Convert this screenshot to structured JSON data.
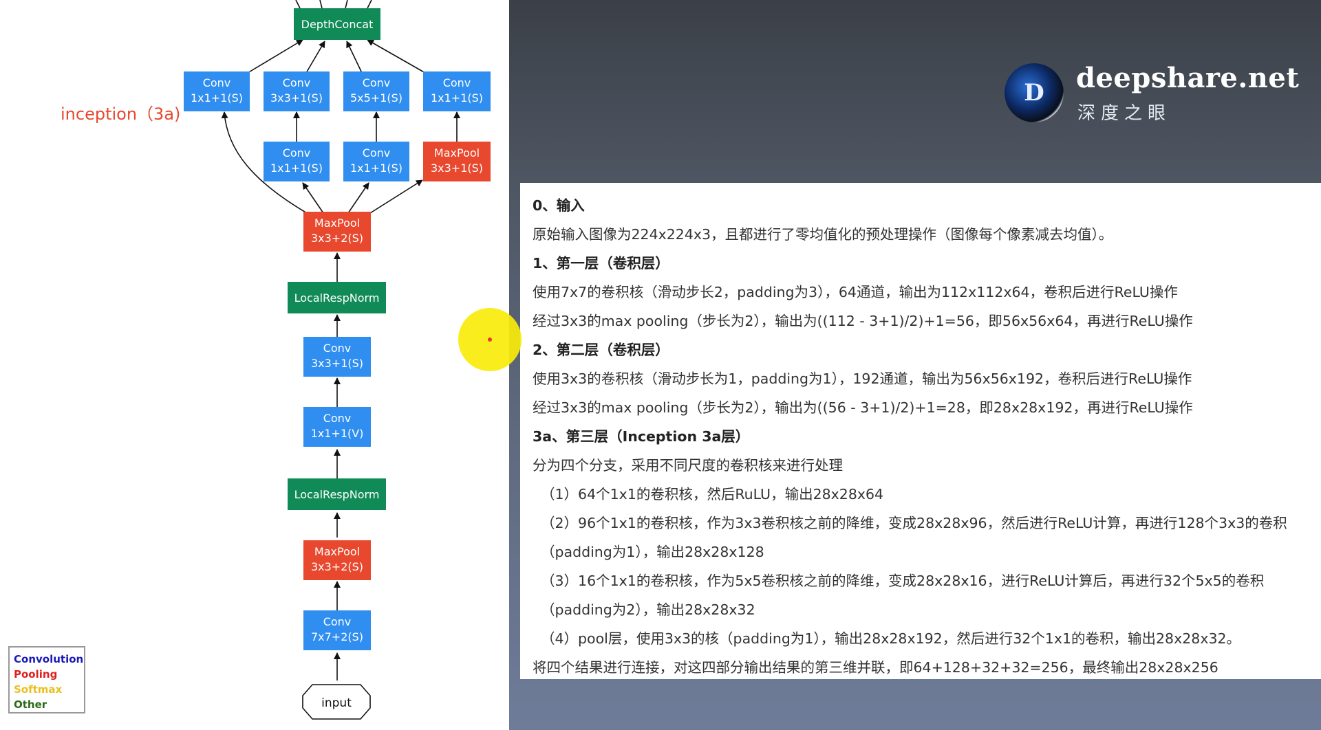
{
  "diagram": {
    "label": "inception（3a)",
    "nodes": {
      "depthconcat": [
        "DepthConcat"
      ],
      "conv_1x1_a": [
        "Conv",
        "1x1+1(S)"
      ],
      "conv_3x3": [
        "Conv",
        "3x3+1(S)"
      ],
      "conv_5x5": [
        "Conv",
        "5x5+1(S)"
      ],
      "conv_1x1_b": [
        "Conv",
        "1x1+1(S)"
      ],
      "conv_1x1_c": [
        "Conv",
        "1x1+1(S)"
      ],
      "conv_1x1_d": [
        "Conv",
        "1x1+1(S)"
      ],
      "maxpool_3x3_s1": [
        "MaxPool",
        "3x3+1(S)"
      ],
      "maxpool_3x3_s2_top": [
        "MaxPool",
        "3x3+2(S)"
      ],
      "localrespnorm_top": [
        "LocalRespNorm"
      ],
      "conv_3x3_s": [
        "Conv",
        "3x3+1(S)"
      ],
      "conv_1x1_v": [
        "Conv",
        "1x1+1(V)"
      ],
      "localrespnorm_bottom": [
        "LocalRespNorm"
      ],
      "maxpool_3x3_s2_bottom": [
        "MaxPool",
        "3x3+2(S)"
      ],
      "conv_7x7": [
        "Conv",
        "7x7+2(S)"
      ],
      "input": [
        "input"
      ]
    },
    "colors": {
      "convolution": "#2f8ef0",
      "pooling": "#e8482e",
      "norm_concat": "#108a56"
    }
  },
  "legend": {
    "items": [
      {
        "label": "Convolution",
        "color": "#1a1ab8"
      },
      {
        "label": "Pooling",
        "color": "#e02020"
      },
      {
        "label": "Softmax",
        "color": "#e8c020"
      },
      {
        "label": "Other",
        "color": "#2a6a1a"
      }
    ]
  },
  "logo": {
    "letter": "D",
    "title": "deepshare.net",
    "subtitle": "深度之眼"
  },
  "notes": {
    "lines": [
      "0、输入",
      "原始输入图像为224x224x3，且都进行了零均值化的预处理操作（图像每个像素减去均值）。",
      "1、第一层（卷积层）",
      "使用7x7的卷积核（滑动步长2，padding为3），64通道，输出为112x112x64，卷积后进行ReLU操作",
      "经过3x3的max pooling（步长为2），输出为((112 - 3+1)/2)+1=56，即56x56x64，再进行ReLU操作",
      "2、第二层（卷积层）",
      "使用3x3的卷积核（滑动步长为1，padding为1），192通道，输出为56x56x192，卷积后进行ReLU操作",
      "经过3x3的max pooling（步长为2），输出为((56 - 3+1)/2)+1=28，即28x28x192，再进行ReLU操作",
      "3a、第三层（Inception 3a层）",
      "分为四个分支，采用不同尺度的卷积核来进行处理",
      "（1）64个1x1的卷积核，然后RuLU，输出28x28x64",
      "（2）96个1x1的卷积核，作为3x3卷积核之前的降维，变成28x28x96，然后进行ReLU计算，再进行128个3x3的卷积",
      "（padding为1），输出28x28x128",
      "（3）16个1x1的卷积核，作为5x5卷积核之前的降维，变成28x28x16，进行ReLU计算后，再进行32个5x5的卷积",
      "（padding为2），输出28x28x32",
      "（4）pool层，使用3x3的核（padding为1），输出28x28x192，然后进行32个1x1的卷积，输出28x28x32。",
      "将四个结果进行连接，对这四部分输出结果的第三维并联，即64+128+32+32=256，最终输出28x28x256"
    ]
  }
}
